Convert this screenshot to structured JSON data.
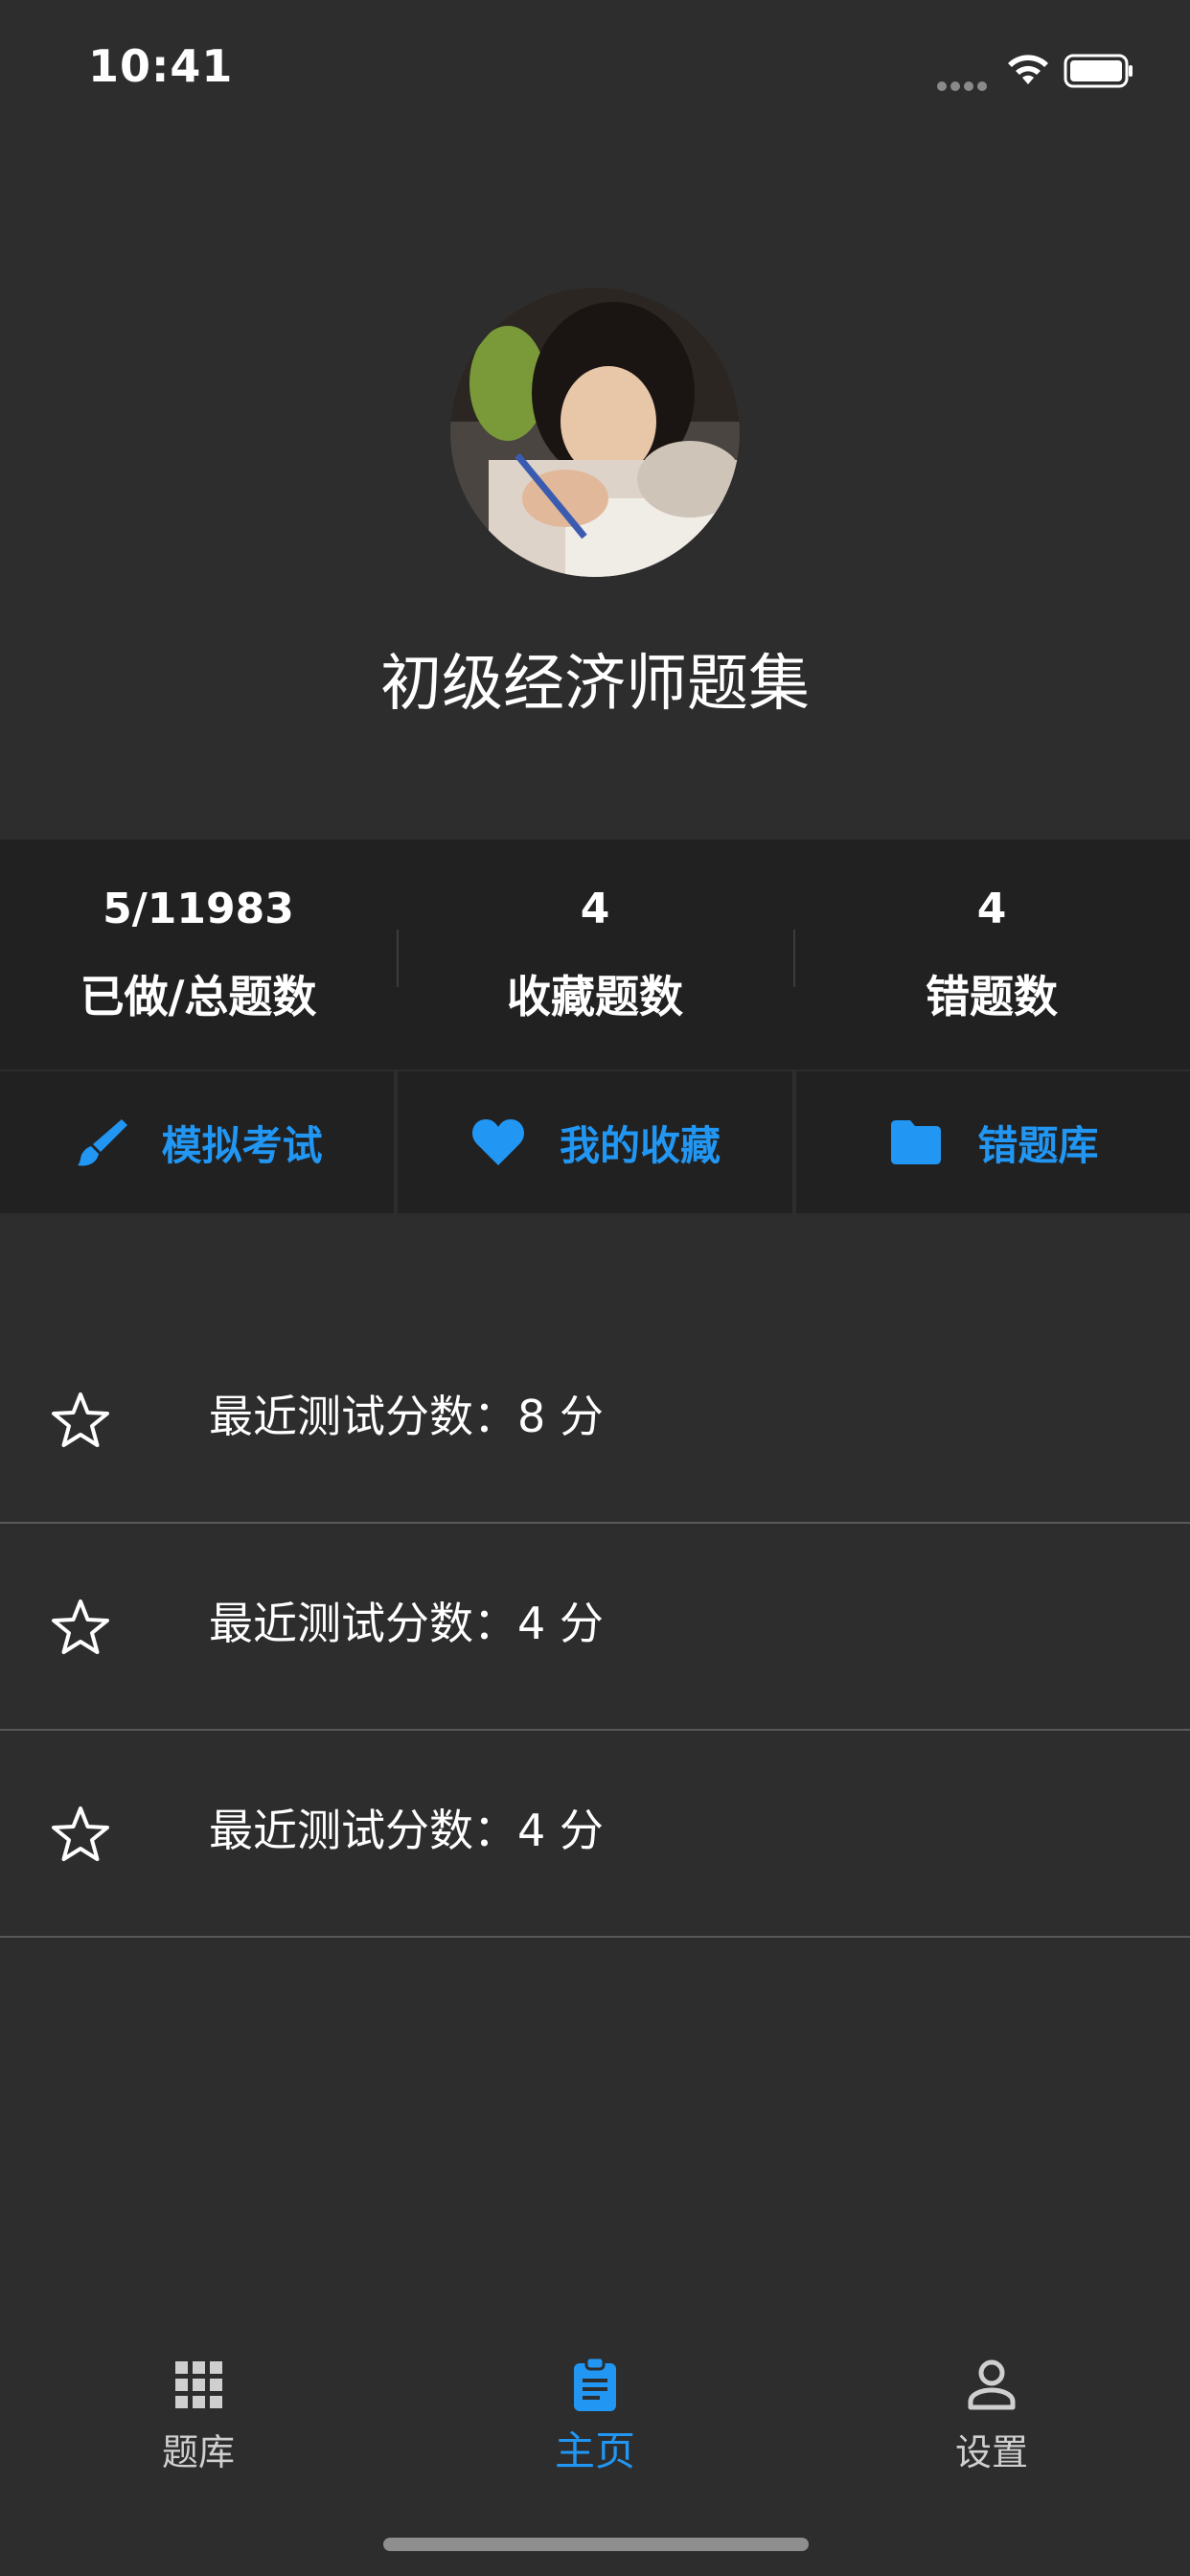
{
  "status_bar": {
    "time": "10:41"
  },
  "profile": {
    "title": "初级经济师题集"
  },
  "stats": [
    {
      "value": "5/11983",
      "label": "已做/总题数"
    },
    {
      "value": "4",
      "label": "收藏题数"
    },
    {
      "value": "4",
      "label": "错题数"
    }
  ],
  "actions": [
    {
      "label": "模拟考试",
      "icon": "brush-icon"
    },
    {
      "label": "我的收藏",
      "icon": "heart-icon"
    },
    {
      "label": "错题库",
      "icon": "folder-icon"
    }
  ],
  "scores": [
    {
      "text": "最近测试分数：8 分",
      "icon": "star-outline-icon"
    },
    {
      "text": "最近测试分数：4 分",
      "icon": "star-outline-icon"
    },
    {
      "text": "最近测试分数：4 分",
      "icon": "star-outline-icon"
    }
  ],
  "tabbar": [
    {
      "label": "题库",
      "icon": "grid-icon",
      "active": false
    },
    {
      "label": "主页",
      "icon": "clipboard-icon",
      "active": true
    },
    {
      "label": "设置",
      "icon": "person-icon",
      "active": false
    }
  ],
  "colors": {
    "background": "#2d2d2d",
    "panel": "#212121",
    "accent": "#2196f3",
    "divider": "#585858"
  }
}
